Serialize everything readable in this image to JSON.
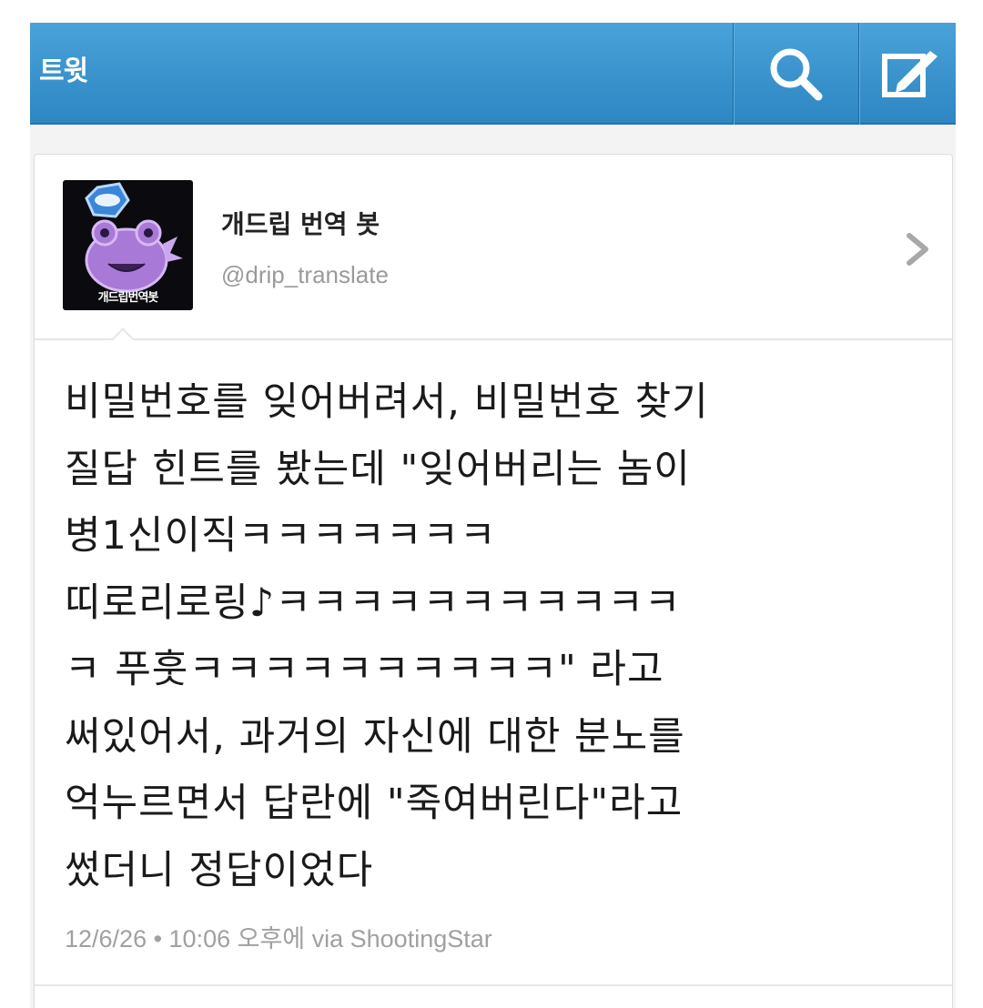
{
  "topbar": {
    "title": "트윗",
    "icons": [
      "search-icon",
      "compose-icon"
    ],
    "colors": {
      "bar": "#3a93cd",
      "icon": "#ffffff"
    }
  },
  "tweet": {
    "avatar_label": "개드립번역봇",
    "display_name": "개드립 번역 봇",
    "handle": "@drip_translate",
    "text": "비밀번호를 잊어버려서, 비밀번호 찾기\n질답 힌트를 봤는데 \"잊어버리는 놈이\n병1신이직ㅋㅋㅋㅋㅋㅋㅋ\n띠로리로링♪ㅋㅋㅋㅋㅋㅋㅋㅋㅋㅋㅋ\nㅋ 푸훗ㅋㅋㅋㅋㅋㅋㅋㅋㅋㅋ\" 라고\n써있어서, 과거의 자신에 대한 분노를\n억누르면서 답란에 \"죽여버린다\"라고\n썼더니 정답이었다",
    "meta": "12/6/26 • 10:06 오후에 via ShootingStar"
  }
}
